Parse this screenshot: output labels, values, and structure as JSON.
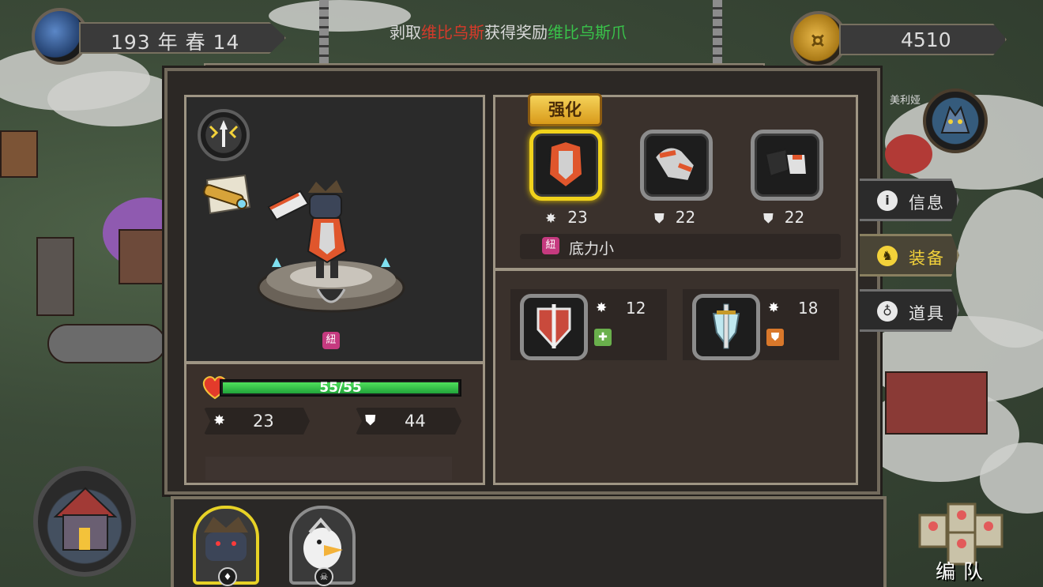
{
  "hud": {
    "date": "193 年 春 14",
    "gold": "4510"
  },
  "notice": {
    "prefix": "剥取",
    "target": "维比乌斯",
    "middle": "获得奖励",
    "reward": "维比乌斯爪"
  },
  "hero": {
    "name": "美利娅",
    "hp_text": "55/55",
    "hp_fraction": 1.0,
    "attack": "23",
    "defense": "44"
  },
  "equipment": {
    "enhance_label": "强化",
    "slots": [
      {
        "stat_icon": "attack-icon",
        "value": "23",
        "selected": true
      },
      {
        "stat_icon": "defense-icon",
        "value": "22",
        "selected": false
      },
      {
        "stat_icon": "defense-icon",
        "value": "22",
        "selected": false
      }
    ],
    "trait_badge": "紐",
    "trait": "底力小"
  },
  "inventory": [
    {
      "icon": "attack-icon",
      "value": "12",
      "badge_color": "#6ab04c"
    },
    {
      "icon": "attack-icon",
      "value": "18",
      "badge_color": "#d9782b"
    }
  ],
  "side_tabs": [
    {
      "label": "信息",
      "icon": "info-icon",
      "glyph": "i"
    },
    {
      "label": "装备",
      "icon": "helmet-icon",
      "glyph": "♞"
    },
    {
      "label": "道具",
      "icon": "potion-icon",
      "glyph": "♁"
    }
  ],
  "bottom": {
    "team_label": "编队"
  },
  "colors": {
    "accent_gold": "#f0d21c",
    "hp_green": "#21a33a",
    "notice_red": "#d63a2a",
    "notice_green": "#39c24a"
  }
}
